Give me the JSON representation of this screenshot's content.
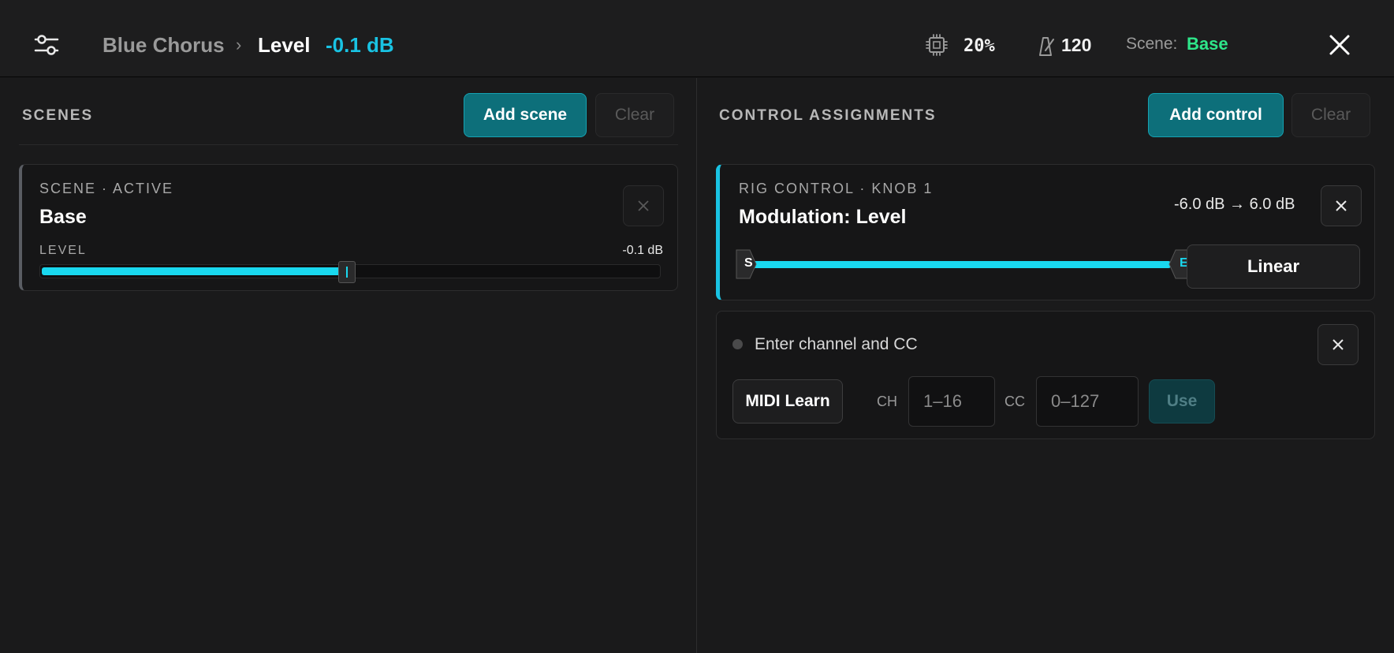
{
  "header": {
    "breadcrumb_parent": "Blue Chorus",
    "breadcrumb_separator": "›",
    "breadcrumb_current": "Level",
    "current_value": "-0.1 dB",
    "cpu_value": "20%",
    "tempo_value": "120",
    "scene_label": "Scene:",
    "scene_value": "Base"
  },
  "scenes": {
    "title": "SCENES",
    "add_label": "Add scene",
    "clear_label": "Clear",
    "card": {
      "eyebrow": "SCENE · ACTIVE",
      "name": "Base",
      "param_label": "LEVEL",
      "param_value": "-0.1 dB",
      "slider_fraction": 0.495
    }
  },
  "controls": {
    "title": "CONTROL ASSIGNMENTS",
    "add_label": "Add control",
    "clear_label": "Clear",
    "rig": {
      "eyebrow": "RIG CONTROL · KNOB 1",
      "name": "Modulation: Level",
      "range": "-6.0 dB → 6.0 dB",
      "start_marker": "S",
      "end_marker": "E",
      "curve_label": "Linear"
    },
    "midi": {
      "status": "Enter channel and CC",
      "learn_label": "MIDI Learn",
      "ch_label": "CH",
      "ch_placeholder": "1–16",
      "cc_label": "CC",
      "cc_placeholder": "0–127",
      "use_label": "Use"
    }
  },
  "colors": {
    "accent": "#19c3e3",
    "scene_green": "#2ee68a",
    "primary_button": "#0d6f7a"
  },
  "icons": {
    "menu": "sliders-icon",
    "cpu": "cpu-chip-icon",
    "tempo": "metronome-icon",
    "close": "close-icon"
  }
}
